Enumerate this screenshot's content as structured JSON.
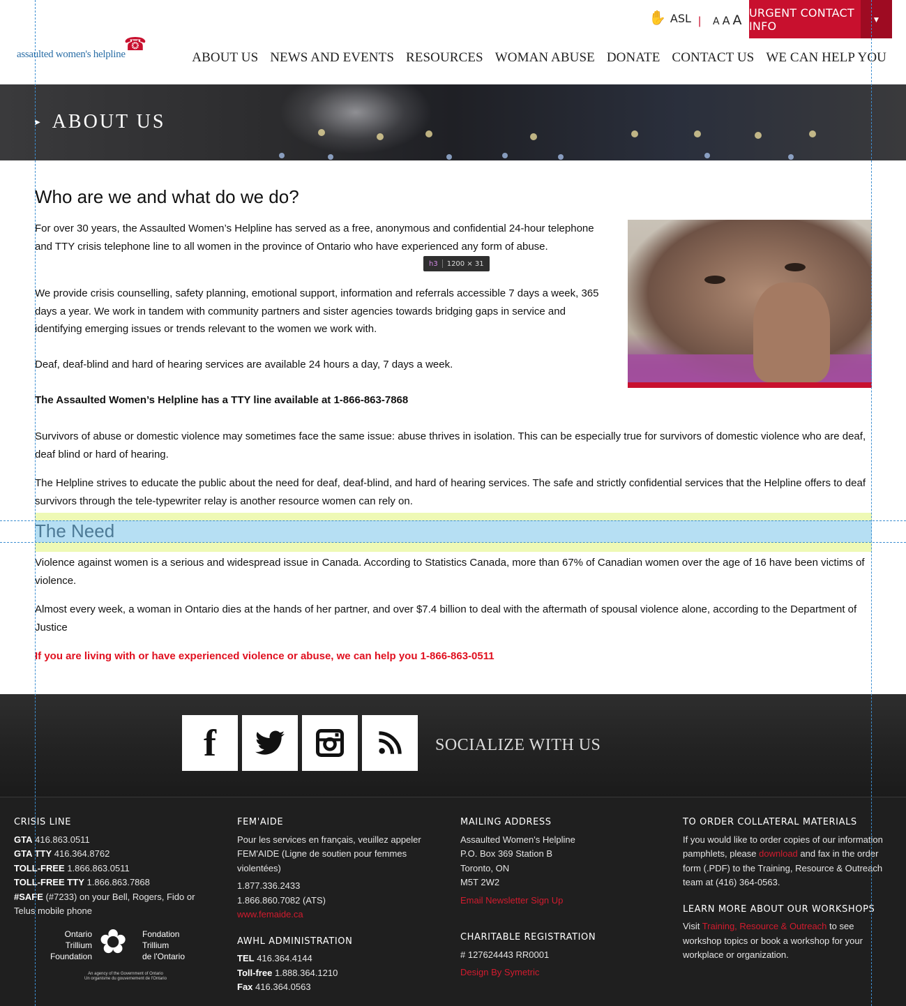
{
  "header": {
    "asl_label": "ASL",
    "separator": "|",
    "text_size": [
      "A",
      "A",
      "A"
    ],
    "urgent_label": "URGENT CONTACT INFO",
    "logo_text": "assaulted women's helpline",
    "nav": [
      "ABOUT US",
      "NEWS AND EVENTS",
      "RESOURCES",
      "WOMAN ABUSE",
      "DONATE",
      "CONTACT US",
      "WE CAN HELP YOU"
    ]
  },
  "hero": {
    "title": "ABOUT US"
  },
  "devtools": {
    "tag": "h3",
    "dims": "1200 × 31"
  },
  "main": {
    "heading": "Who are we and what do we do?",
    "p1": "For over 30 years, the Assaulted Women’s Helpline has served as a free, anonymous and confidential 24-hour telephone and TTY crisis telephone line to all women in the province of Ontario who have experienced any form of abuse.",
    "p2": "We provide crisis counselling, safety planning, emotional support, information and referrals accessible 7 days a week, 365 days a year.  We work in tandem with community partners and sister agencies towards bridging gaps in service and identifying emerging issues or trends relevant to the women we work with.",
    "p3": "Deaf, deaf-blind and hard of hearing services are available 24 hours a day, 7 days a week.",
    "p4": "The Assaulted Women’s Helpline has a TTY line available at 1-866-863-7868",
    "p5": "Survivors of abuse or domestic violence may sometimes face the same issue: abuse thrives in isolation. This can be especially true for survivors of domestic violence who are deaf, deaf blind or hard of hearing.",
    "p6": "The Helpline strives to educate the public about the need for deaf, deaf-blind, and hard of hearing services. The safe and strictly confidential services that the Helpline offers to deaf survivors through the tele-typewriter relay is another resource women can rely on.",
    "need_heading": "The Need",
    "p7": "Violence against women is a serious and widespread issue in Canada. According to Statistics Canada, more than 67% of Canadian women over the age of 16 have been victims of violence.",
    "p8": "Almost every week, a woman in Ontario dies at the hands of her partner, and over $7.4 billion to deal with the aftermath of spousal violence alone, according to the Department of Justice",
    "p9": "If you are living with or have experienced violence or abuse, we can help you 1-866-863-0511"
  },
  "social": {
    "tiles": [
      "facebook-icon",
      "twitter-icon",
      "instagram-icon",
      "rss-icon"
    ],
    "tagline": "SOCIALIZE WITH US"
  },
  "footer": {
    "crisis": {
      "title": "CRISIS LINE",
      "gta_label": "GTA",
      "gta": "416.863.0511",
      "gtatty_label": "GTA TTY",
      "gtatty": "416.364.8762",
      "tollfree_label": "TOLL-FREE",
      "tollfree": "1.866.863.0511",
      "tollfreetty_label": "TOLL-FREE TTY",
      "tollfreetty": "1.866.863.7868",
      "safe_label": "#SAFE",
      "safe_text": "(#7233) on your Bell, Rogers, Fido or Telus mobile phone"
    },
    "trillium": {
      "left": [
        "Ontario",
        "Trillium",
        "Foundation"
      ],
      "right": [
        "Fondation",
        "Trillium",
        "de l'Ontario"
      ],
      "agency": [
        "An agency of the Government of Ontario",
        "Un organisme du gouvernement de l'Ontario"
      ]
    },
    "femaide": {
      "title": "FEM'AIDE",
      "text": "Pour les services en français, veuillez appeler FEM'AIDE (Ligne de soutien pour femmes violentées)",
      "phone1": "1.877.336.2433",
      "phone2": "1.866.860.7082 (ATS)",
      "link": "www.femaide.ca"
    },
    "admin": {
      "title": "AWHL ADMINISTRATION",
      "tel_label": "TEL",
      "tel": "416.364.4144",
      "tollfree_label": "Toll-free",
      "tollfree": "1.888.364.1210",
      "fax_label": "Fax",
      "fax": "416.364.0563"
    },
    "mailing": {
      "title": "MAILING ADDRESS",
      "lines": [
        "Assaulted Women's Helpline",
        "P.O. Box 369 Station B",
        "Toronto, ON",
        "M5T 2W2"
      ],
      "newsletter": "Email Newsletter Sign Up"
    },
    "charitable": {
      "title": "CHARITABLE REGISTRATION",
      "number": "# 127624443 RR0001",
      "design": "Design By Symetric"
    },
    "order": {
      "title": "TO ORDER COLLATERAL MATERIALS",
      "pre": "If you would like to order copies of our information pamphlets, please ",
      "link": "download",
      "post": " and fax in the order form (.PDF) to the Training, Resource & Outreach team at (416) 364-0563."
    },
    "workshops": {
      "title": "LEARN MORE ABOUT OUR WORKSHOPS",
      "pre": "Visit ",
      "link": "Training, Resource & Outreach",
      "post": " to see workshop topics or book a workshop for your workplace or organization."
    }
  }
}
